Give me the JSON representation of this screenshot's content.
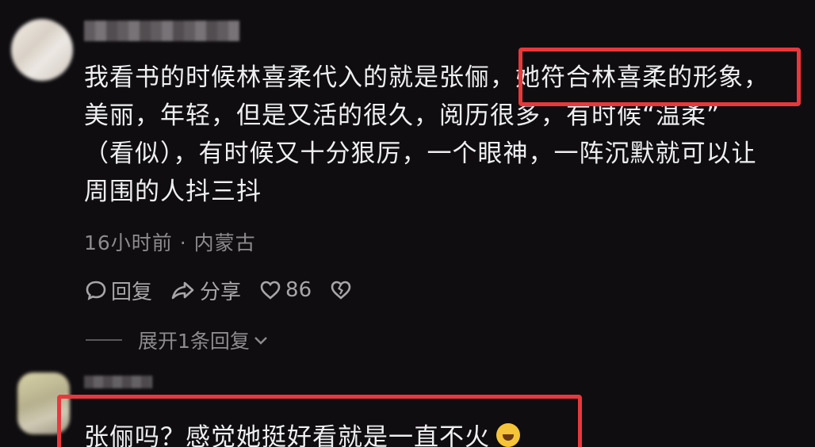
{
  "comment": {
    "lines": [
      "我看书的时候林喜柔代入的就是张俪，她符合林喜柔的形象，",
      "美丽，年轻，但是又活的很久，阅历很多，有时候“温柔”",
      "（看似），有时候又十分狠厉，一个眼神，一阵沉默就可以让",
      "周围的人抖三抖"
    ],
    "meta": "16小时前 · 内蒙古",
    "actions": {
      "reply_label": "回复",
      "share_label": "分享",
      "like_count": "86"
    },
    "expand_label": "展开1条回复"
  },
  "reply": {
    "text": "张俪吗？感觉她挺好看就是一直不火",
    "emoji": "laughing-crying-emoji"
  },
  "colors": {
    "background": "#0f0d10",
    "text": "#efeff1",
    "muted": "#8e8b8f",
    "highlight": "#e8383c"
  }
}
